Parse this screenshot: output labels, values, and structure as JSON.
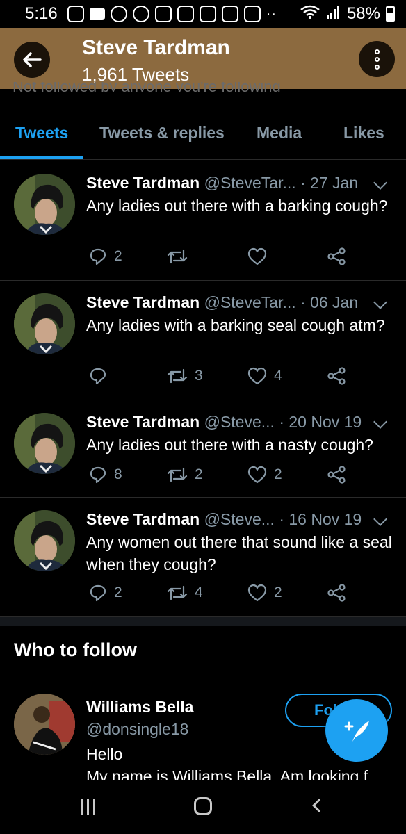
{
  "status_bar": {
    "time": "5:16",
    "battery": "58%"
  },
  "header": {
    "title": "Steve Tardman",
    "subtitle": "1,961 Tweets"
  },
  "hidden_banner_text": "Not followed by anyone you're following",
  "tabs": [
    {
      "label": "Tweets",
      "active": true
    },
    {
      "label": "Tweets & replies",
      "active": false
    },
    {
      "label": "Media",
      "active": false
    },
    {
      "label": "Likes",
      "active": false
    }
  ],
  "tweets": [
    {
      "name": "Steve Tardman",
      "handle": "@SteveTar...",
      "date": "· 27 Jan",
      "text": "Any ladies out there with a barking cough?",
      "replies": "2",
      "retweets": "",
      "likes": ""
    },
    {
      "name": "Steve Tardman",
      "handle": "@SteveTar...",
      "date": "· 06 Jan",
      "text": "Any ladies with a barking seal cough atm?",
      "replies": "",
      "retweets": "3",
      "likes": "4"
    },
    {
      "name": "Steve Tardman",
      "handle": "@Steve...",
      "date": "· 20 Nov 19",
      "text": "Any ladies out there with a nasty cough?",
      "replies": "8",
      "retweets": "2",
      "likes": "2"
    },
    {
      "name": "Steve Tardman",
      "handle": "@Steve...",
      "date": "· 16 Nov 19",
      "text": "Any women out there that sound like a seal when they cough?",
      "replies": "2",
      "retweets": "4",
      "likes": "2"
    }
  ],
  "who_to_follow": {
    "title": "Who to follow",
    "name": "Williams Bella",
    "handle": "@donsingle18",
    "bio_line1": "Hello",
    "bio_line2": "My name is Williams Bella. Am looking f",
    "follow_label": "Fol"
  },
  "colors": {
    "accent": "#1da1f2",
    "header_bg": "#8c6a3f",
    "muted": "#8899a6"
  }
}
